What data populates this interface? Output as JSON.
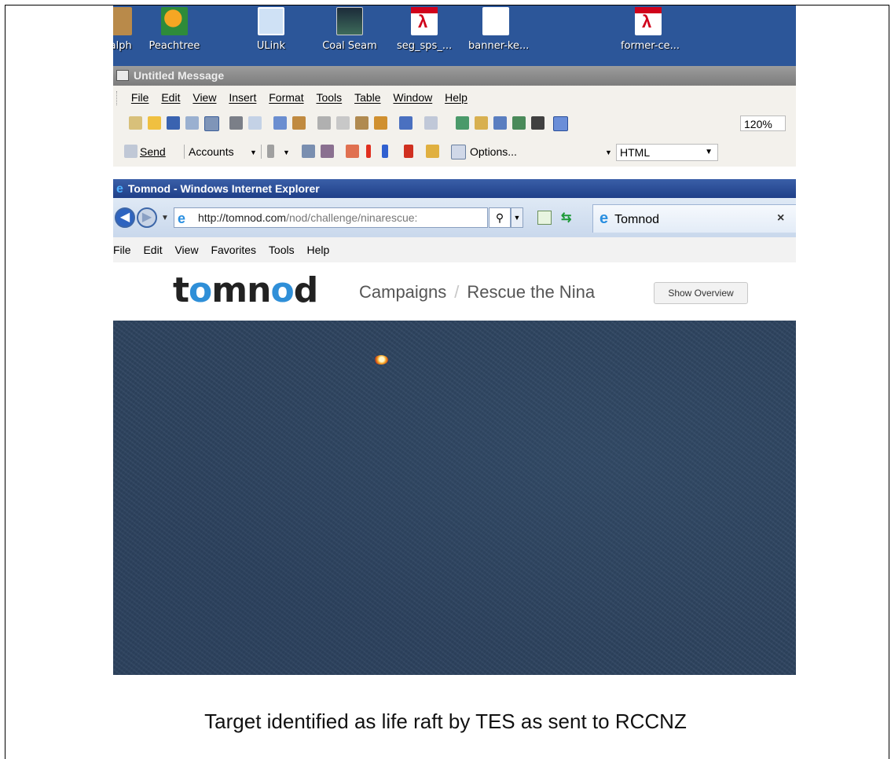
{
  "desktop": {
    "icons": [
      {
        "label": "ralph",
        "icon": "contact-icon"
      },
      {
        "label": "Peachtree",
        "icon": "peachtree-icon"
      },
      {
        "label": "ULink",
        "icon": "ulink-icon"
      },
      {
        "label": "Coal Seam",
        "icon": "coal-seam-icon"
      },
      {
        "label": "seg_sps_...",
        "icon": "pdf-icon"
      },
      {
        "label": "banner-ke...",
        "icon": "blank-file-icon"
      },
      {
        "label": "former-ce...",
        "icon": "pdf-icon"
      }
    ]
  },
  "message_window": {
    "title": "Untitled Message",
    "menu": [
      "File",
      "Edit",
      "View",
      "Insert",
      "Format",
      "Tools",
      "Table",
      "Window",
      "Help"
    ],
    "zoom": "120%",
    "toolbar2": {
      "send": "Send",
      "accounts": "Accounts",
      "options": "Options...",
      "format": "HTML"
    }
  },
  "browser": {
    "title": "Tomnod - Windows Internet Explorer",
    "url_host": "http://tomnod.com",
    "url_path": "/nod/challenge/ninarescue:",
    "tab_label": "Tomnod",
    "menu": [
      "File",
      "Edit",
      "View",
      "Favorites",
      "Tools",
      "Help"
    ]
  },
  "page": {
    "logo": "tomnod",
    "breadcrumb": [
      "Campaigns",
      "Rescue the Nina"
    ],
    "overview_button": "Show Overview"
  },
  "caption": "Target identified as life raft by TES as sent to RCCNZ"
}
